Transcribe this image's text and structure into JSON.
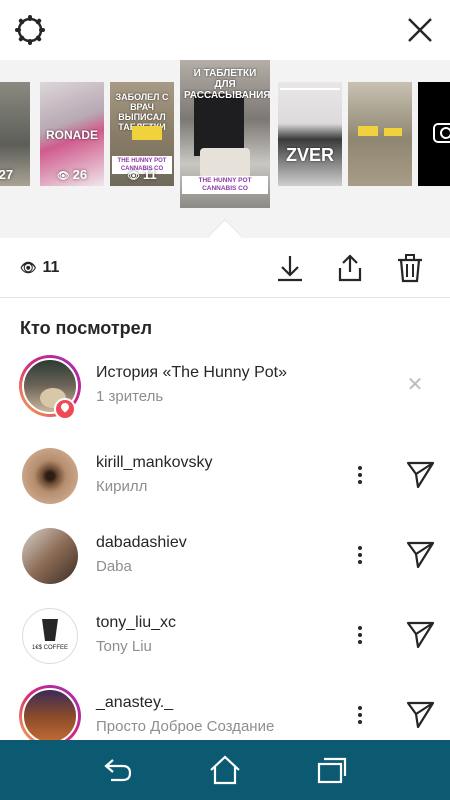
{
  "header": {
    "settings_icon": "gear-icon",
    "close_icon": "close-icon"
  },
  "stories": [
    {
      "views": "27",
      "caption": "",
      "tag": ""
    },
    {
      "views": "26",
      "caption": "RONADE",
      "tag": ""
    },
    {
      "views": "11",
      "caption": "ЗАБОЛЕЛ С ВРАЧ ВЫПИСАЛ ТАБЛЕТКИ",
      "tag": "THE HUNNY POT CANNABIS CO"
    },
    {
      "views": "",
      "caption": "И ТАБЛЕТКИ ДЛЯ РАССАСЫВАНИЯ",
      "tag": "THE HUNNY POT CANNABIS CO"
    },
    {
      "views": "",
      "caption": "ZVER",
      "tag": ""
    },
    {
      "views": "",
      "caption": "",
      "tag": ""
    },
    {
      "views": "",
      "caption": "",
      "tag": ""
    }
  ],
  "actions": {
    "view_count": "11",
    "download_icon": "download-icon",
    "share_icon": "share-icon",
    "delete_icon": "trash-icon"
  },
  "viewers_heading": "Кто посмотрел",
  "highlight": {
    "title": "История «The Hunny Pot»",
    "subtitle": "1 зритель"
  },
  "viewers": [
    {
      "username": "kirill_mankovsky",
      "name": "Кирилл"
    },
    {
      "username": "dabadashiev",
      "name": "Daba"
    },
    {
      "username": "tony_liu_xc",
      "name": "Tony Liu"
    },
    {
      "username": "_anastey._",
      "name": "Просто Доброе Создание"
    }
  ],
  "avatar_labels": {
    "tony_logo": "1€$ COFFEE"
  },
  "navbar": {
    "back_icon": "back-icon",
    "home_icon": "home-icon",
    "recents_icon": "recents-icon"
  },
  "colors": {
    "navbar": "#0b5a72",
    "accent": "#8e3aa8",
    "story_ring": "#c13584"
  }
}
